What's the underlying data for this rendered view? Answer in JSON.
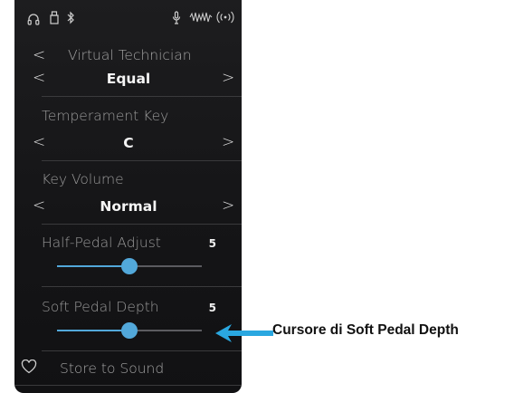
{
  "status_bar": {
    "icons": [
      "headphones-icon",
      "usb-icon",
      "bluetooth-icon",
      "microphone-icon",
      "audio-wave-icon",
      "wireless-signal-icon"
    ]
  },
  "header": {
    "title": "Virtual Technician",
    "back_icon": "chevron-left-icon"
  },
  "selector_1": {
    "value": "Equal"
  },
  "temperament_key": {
    "label": "Temperament Key",
    "value": "C"
  },
  "key_volume": {
    "label": "Key Volume",
    "value": "Normal"
  },
  "half_pedal_adjust": {
    "label": "Half-Pedal Adjust",
    "value": "5",
    "level_fraction": 0.5
  },
  "soft_pedal_depth": {
    "label": "Soft Pedal Depth",
    "value": "5",
    "level_fraction": 0.5
  },
  "footer": {
    "label": "Store to Sound",
    "icon": "heart-icon"
  },
  "annotation": {
    "label": "Cursore di Soft Pedal Depth",
    "arrow_color": "#2aa7e0"
  },
  "colors": {
    "accent": "#52a8da",
    "background": "#1a1a1c"
  }
}
